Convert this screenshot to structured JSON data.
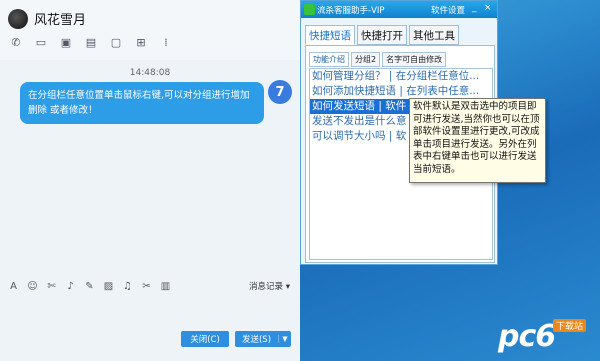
{
  "chat": {
    "contact_name": "风花雪月",
    "time": "14:48:08",
    "message": "在分组栏任意位置单击鼠标右键,可以对分组进行增加 删除 或者修改！",
    "my_avatar_letter": "7",
    "history_label": "消息记录 ▾",
    "close_label": "关闭(C)",
    "send_label": "发送(S)",
    "toolbar_icons": [
      "phone-icon",
      "video-icon",
      "screen-share-icon",
      "folder-icon",
      "remote-desktop-icon",
      "add-member-icon",
      "apps-icon"
    ],
    "input_icons": [
      "font-icon",
      "emoji-icon",
      "screenshot-icon",
      "voice-icon",
      "pen-icon",
      "image-icon",
      "music-icon",
      "cut-icon",
      "trash-icon"
    ]
  },
  "assistant": {
    "title": "流杀客服助手-VIP",
    "settings_label": "软件设置",
    "minimize": "_",
    "close": "×",
    "tabs": [
      "快捷短语",
      "快捷打开",
      "其他工具"
    ],
    "subtabs": [
      "功能介绍",
      "分组2",
      "名字可自由修改"
    ],
    "rows": [
      "如何管理分组？ | 在分组栏任意位...",
      "如何添加快捷短语 | 在列表中任意...",
      "如何发送短语 | 软件",
      "发送不发出是什么意",
      "可以调节大小吗 | 软"
    ],
    "tooltip": "软件默认是双击选中的项目即可进行发送,当然你也可以在顶部软件设置里进行更改,可改成单击项目进行发送。另外在列表中右键单击也可以进行发送当前短语。"
  },
  "watermark": {
    "text": "pc6",
    "badge": "下载站"
  }
}
